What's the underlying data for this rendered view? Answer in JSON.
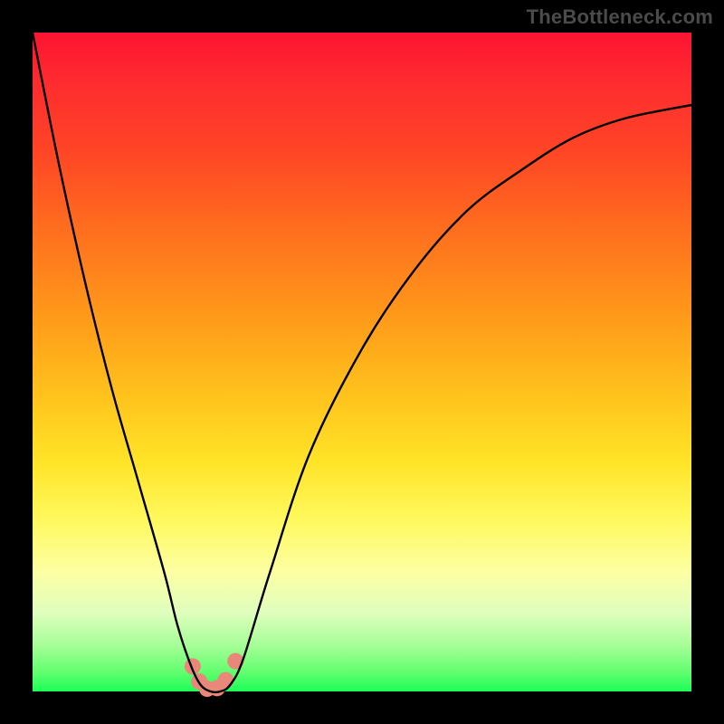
{
  "watermark": "TheBottleneck.com",
  "chart_data": {
    "type": "line",
    "title": "",
    "xlabel": "",
    "ylabel": "",
    "xlim": [
      0,
      100
    ],
    "ylim": [
      0,
      100
    ],
    "grid": false,
    "background_gradient": [
      "#fd1432",
      "#ff961a",
      "#fff95e",
      "#1bfe58"
    ],
    "series": [
      {
        "name": "bottleneck-curve",
        "color": "#000000",
        "x": [
          0,
          4,
          8,
          12,
          16,
          20,
          22,
          24,
          25.5,
          27,
          28.5,
          30,
          32,
          36,
          42,
          50,
          58,
          66,
          74,
          82,
          90,
          100
        ],
        "y": [
          100,
          80,
          62,
          46,
          32,
          18,
          10,
          4,
          1,
          0,
          0,
          1,
          5,
          18,
          36,
          52,
          64,
          73,
          79,
          84,
          87,
          89
        ]
      }
    ],
    "markers": {
      "name": "highlight-dots",
      "color": "#e8877a",
      "radius_px": 9,
      "points": [
        {
          "x": 24.3,
          "y": 3.8
        },
        {
          "x": 25.3,
          "y": 1.5
        },
        {
          "x": 26.5,
          "y": 0.4
        },
        {
          "x": 28.0,
          "y": 0.5
        },
        {
          "x": 29.3,
          "y": 1.7
        },
        {
          "x": 30.8,
          "y": 4.6
        }
      ]
    }
  }
}
